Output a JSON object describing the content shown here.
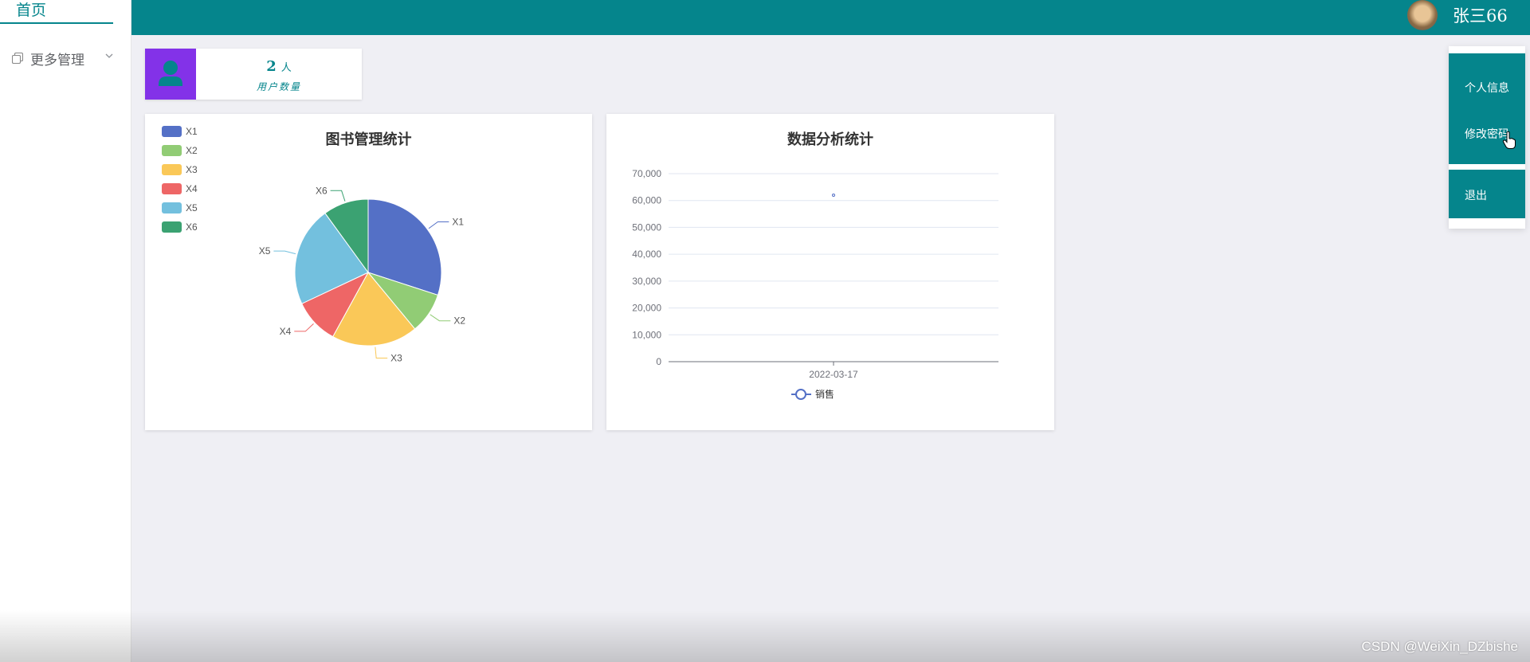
{
  "sidebar": {
    "home_label": "首页",
    "more_label": "更多管理"
  },
  "header": {
    "username": "张三66"
  },
  "stat": {
    "value": "2",
    "unit": "人",
    "label": "用户数量"
  },
  "dropdown": {
    "items": [
      "个人信息",
      "修改密码",
      "退出"
    ]
  },
  "watermark": "CSDN @WeiXin_DZbishe",
  "colors": {
    "primary": "#05858c",
    "stat_icon_bg": "#8332e8"
  },
  "chart_data": [
    {
      "type": "pie",
      "title": "图书管理统计",
      "legend_position": "top-left",
      "series": [
        {
          "name": "X1",
          "value": 30,
          "color": "#5470c6"
        },
        {
          "name": "X2",
          "value": 9,
          "color": "#91cc75"
        },
        {
          "name": "X3",
          "value": 19,
          "color": "#fac858"
        },
        {
          "name": "X4",
          "value": 10,
          "color": "#ee6666"
        },
        {
          "name": "X5",
          "value": 22,
          "color": "#73c0de"
        },
        {
          "name": "X6",
          "value": 10,
          "color": "#3ba272"
        }
      ]
    },
    {
      "type": "line",
      "title": "数据分析统计",
      "x": [
        "2022-03-17"
      ],
      "series": [
        {
          "name": "销售",
          "values": [
            62000
          ],
          "color": "#5470c6"
        }
      ],
      "ylim": [
        0,
        70000
      ],
      "yticks": [
        "0",
        "10,000",
        "20,000",
        "30,000",
        "40,000",
        "50,000",
        "60,000",
        "70,000"
      ],
      "grid": true,
      "legend_position": "bottom"
    }
  ]
}
